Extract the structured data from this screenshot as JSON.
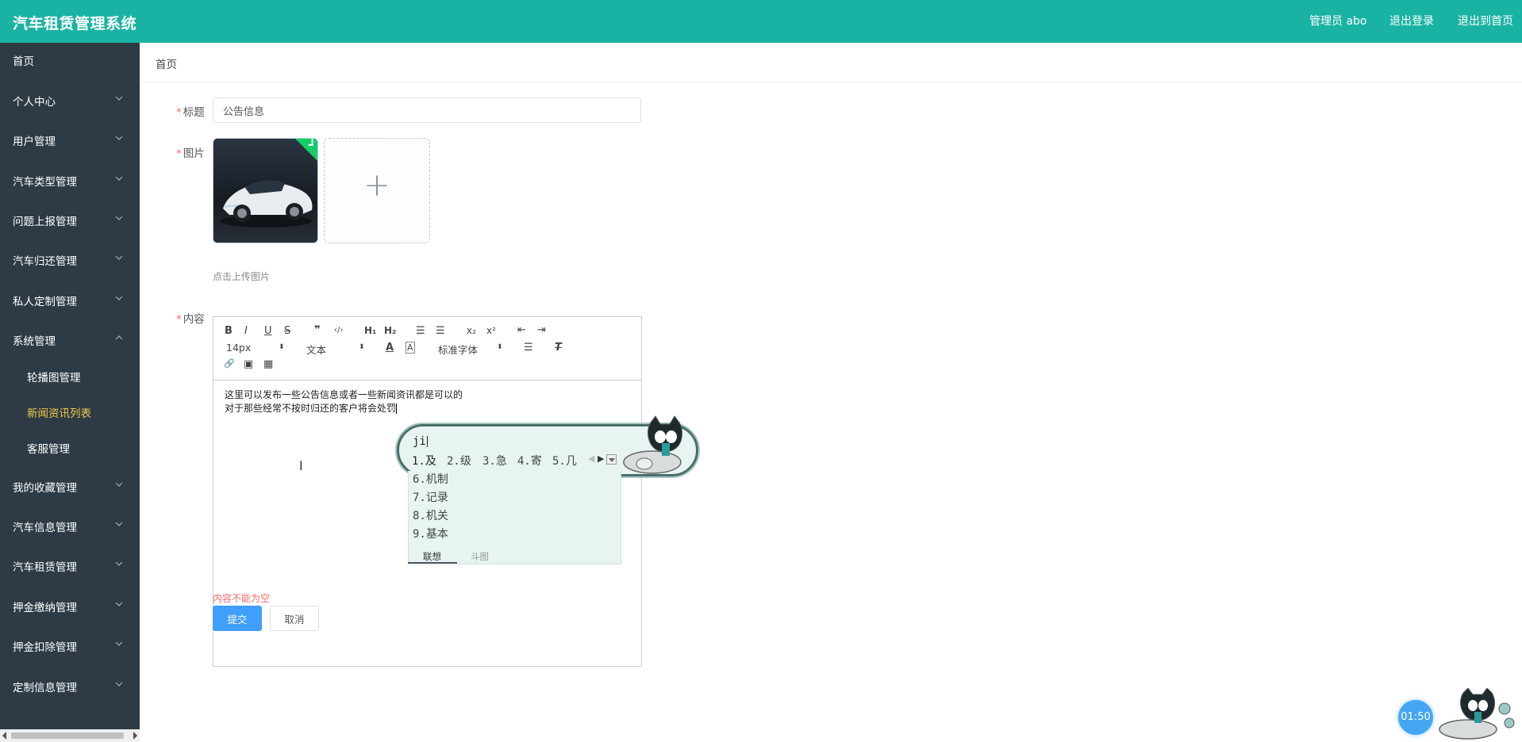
{
  "header": {
    "title": "汽车租赁管理系统",
    "admin": "管理员 abo",
    "logout": "退出登录",
    "home": "退出到首页"
  },
  "sidebar": {
    "items": [
      {
        "label": "首页"
      },
      {
        "label": "个人中心"
      },
      {
        "label": "用户管理"
      },
      {
        "label": "汽车类型管理"
      },
      {
        "label": "问题上报管理"
      },
      {
        "label": "汽车归还管理"
      },
      {
        "label": "私人定制管理"
      },
      {
        "label": "系统管理"
      },
      {
        "label": "我的收藏管理"
      },
      {
        "label": "汽车信息管理"
      },
      {
        "label": "汽车租赁管理"
      },
      {
        "label": "押金缴纳管理"
      },
      {
        "label": "押金扣除管理"
      },
      {
        "label": "定制信息管理"
      }
    ],
    "submenu": [
      {
        "label": "轮播图管理"
      },
      {
        "label": "新闻资讯列表"
      },
      {
        "label": "客服管理"
      }
    ],
    "active_submenu": "新闻资讯列表"
  },
  "breadcrumb": "首页",
  "form": {
    "title_label": "标题",
    "title_value": "公告信息",
    "image_label": "图片",
    "upload_tip": "点击上传图片",
    "content_label": "内容",
    "content_lines": [
      "这里可以发布一些公告信息或者一些新闻资讯都是可以的",
      "对于那些经常不按时归还的客户将会处罚"
    ],
    "error": "内容不能为空",
    "submit": "提交",
    "cancel": "取消",
    "required_mark": "*"
  },
  "toolbar": {
    "bold": "B",
    "italic": "I",
    "underline": "U",
    "strike": "S",
    "quote": "❞",
    "code": "‹/›",
    "h1": "H₁",
    "h2": "H₂",
    "ol": "☰",
    "ul": "☰",
    "sub": "x₂",
    "sup": "x²",
    "outdent": "⇤",
    "indent": "⇥",
    "size": "14px",
    "format": "文本",
    "font": "标准字体",
    "color": "A",
    "bg": "A",
    "align": "☰",
    "clean": "T",
    "link": "🔗",
    "image": "▣",
    "video": "▦"
  },
  "ime": {
    "code": "ji",
    "candidates": [
      "1.及",
      "2.级",
      "3.急",
      "4.寄",
      "5.几"
    ],
    "list": [
      "6.机制",
      "7.记录",
      "8.机关",
      "9.基本"
    ],
    "tabs": [
      "联想",
      "斗图"
    ]
  },
  "timer": "01:50"
}
